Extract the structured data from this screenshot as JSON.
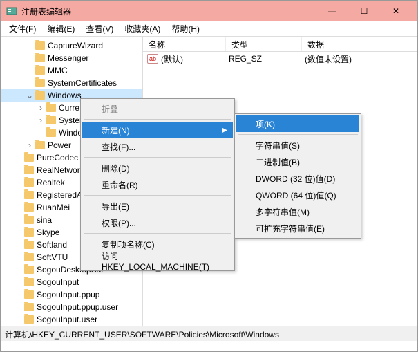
{
  "window": {
    "title": "注册表编辑器"
  },
  "titlebar_buttons": {
    "min": "—",
    "max": "☐",
    "close": "✕"
  },
  "menubar": [
    "文件(F)",
    "编辑(E)",
    "查看(V)",
    "收藏夹(A)",
    "帮助(H)"
  ],
  "tree": [
    {
      "level": 2,
      "expand": "",
      "label": "CaptureWizard"
    },
    {
      "level": 2,
      "expand": "",
      "label": "Messenger"
    },
    {
      "level": 2,
      "expand": "",
      "label": "MMC"
    },
    {
      "level": 2,
      "expand": "",
      "label": "SystemCertificates"
    },
    {
      "level": 2,
      "expand": "v",
      "label": "Windows",
      "selected": true
    },
    {
      "level": 3,
      "expand": ">",
      "label": "Curre"
    },
    {
      "level": 3,
      "expand": ">",
      "label": "Syster"
    },
    {
      "level": 3,
      "expand": "",
      "label": "Windows"
    },
    {
      "level": 2,
      "expand": ">",
      "label": "Power"
    },
    {
      "level": 1,
      "expand": "",
      "label": "PureCodec"
    },
    {
      "level": 1,
      "expand": "",
      "label": "RealNetworks"
    },
    {
      "level": 1,
      "expand": "",
      "label": "Realtek"
    },
    {
      "level": 1,
      "expand": "",
      "label": "RegisteredAppl"
    },
    {
      "level": 1,
      "expand": "",
      "label": "RuanMei"
    },
    {
      "level": 1,
      "expand": "",
      "label": "sina"
    },
    {
      "level": 1,
      "expand": "",
      "label": "Skype"
    },
    {
      "level": 1,
      "expand": "",
      "label": "Softland"
    },
    {
      "level": 1,
      "expand": "",
      "label": "SoftVTU"
    },
    {
      "level": 1,
      "expand": "",
      "label": "SogouDesktopBar"
    },
    {
      "level": 1,
      "expand": "",
      "label": "SogouInput"
    },
    {
      "level": 1,
      "expand": "",
      "label": "SogouInput.ppup"
    },
    {
      "level": 1,
      "expand": "",
      "label": "SogouInput.ppup.user"
    },
    {
      "level": 1,
      "expand": "",
      "label": "SogouInput.user"
    }
  ],
  "list": {
    "headers": [
      "名称",
      "类型",
      "数据"
    ],
    "rows": [
      {
        "icon": "ab",
        "name": "(默认)",
        "type": "REG_SZ",
        "data": "(数值未设置)"
      }
    ]
  },
  "context_main": [
    {
      "label": "折叠",
      "type": "item",
      "disabled": true
    },
    {
      "type": "sep"
    },
    {
      "label": "新建(N)",
      "type": "item",
      "submenu": true,
      "highlighted": true
    },
    {
      "label": "查找(F)...",
      "type": "item"
    },
    {
      "type": "sep"
    },
    {
      "label": "删除(D)",
      "type": "item"
    },
    {
      "label": "重命名(R)",
      "type": "item"
    },
    {
      "type": "sep"
    },
    {
      "label": "导出(E)",
      "type": "item"
    },
    {
      "label": "权限(P)...",
      "type": "item"
    },
    {
      "type": "sep"
    },
    {
      "label": "复制项名称(C)",
      "type": "item"
    },
    {
      "label": "访问 HKEY_LOCAL_MACHINE(T)",
      "type": "item"
    }
  ],
  "context_sub": [
    {
      "label": "项(K)",
      "highlighted": true
    },
    {
      "type": "sep"
    },
    {
      "label": "字符串值(S)"
    },
    {
      "label": "二进制值(B)"
    },
    {
      "label": "DWORD (32 位)值(D)"
    },
    {
      "label": "QWORD (64 位)值(Q)"
    },
    {
      "label": "多字符串值(M)"
    },
    {
      "label": "可扩充字符串值(E)"
    }
  ],
  "statusbar": "计算机\\HKEY_CURRENT_USER\\SOFTWARE\\Policies\\Microsoft\\Windows"
}
